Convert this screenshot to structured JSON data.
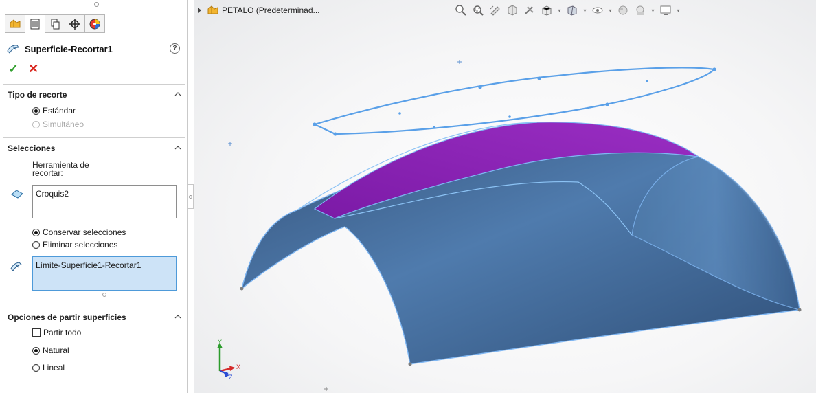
{
  "panel": {
    "tabs": [
      "featuremanager-tab",
      "propertymanager-tab",
      "configurationmanager-tab",
      "dimxpert-tab",
      "displaymanager-tab"
    ],
    "title": "Superficie-Recortar1",
    "help_symbol": "?",
    "ok_symbol": "✓",
    "cancel_symbol": "✕",
    "tipo": {
      "header": "Tipo de recorte",
      "opt1": "Estándar",
      "opt2": "Simultáneo"
    },
    "selecciones": {
      "header": "Selecciones",
      "tool_label_line1": "Herramienta de",
      "tool_label_line2": "recortar:",
      "tool_value": "Croquis2",
      "keep_label": "Conservar selecciones",
      "remove_label": "Eliminar selecciones",
      "faces_value": "Límite-Superficie1-Recortar1"
    },
    "opciones": {
      "header": "Opciones de partir superficies",
      "split_all": "Partir todo",
      "natural": "Natural",
      "lineal": "Lineal"
    }
  },
  "viewport": {
    "tree_root": "PETALO  (Predeterminad...",
    "triad": {
      "x": "X",
      "y": "Y",
      "z": "Z"
    },
    "colors": {
      "surface": "#41699a",
      "trimmed_face": "#8a1bb3",
      "sketch": "#5aa0e8",
      "edge": "#7fb6f2"
    },
    "toolbar_icons": [
      "zoom-to-fit-icon",
      "zoom-to-area-icon",
      "previous-view-icon",
      "section-view-icon",
      "dynamic-annotation-icon",
      "view-orientation-icon",
      "display-style-icon",
      "hide-show-items-icon",
      "edit-appearance-icon",
      "apply-scene-icon",
      "view-settings-icon"
    ]
  }
}
